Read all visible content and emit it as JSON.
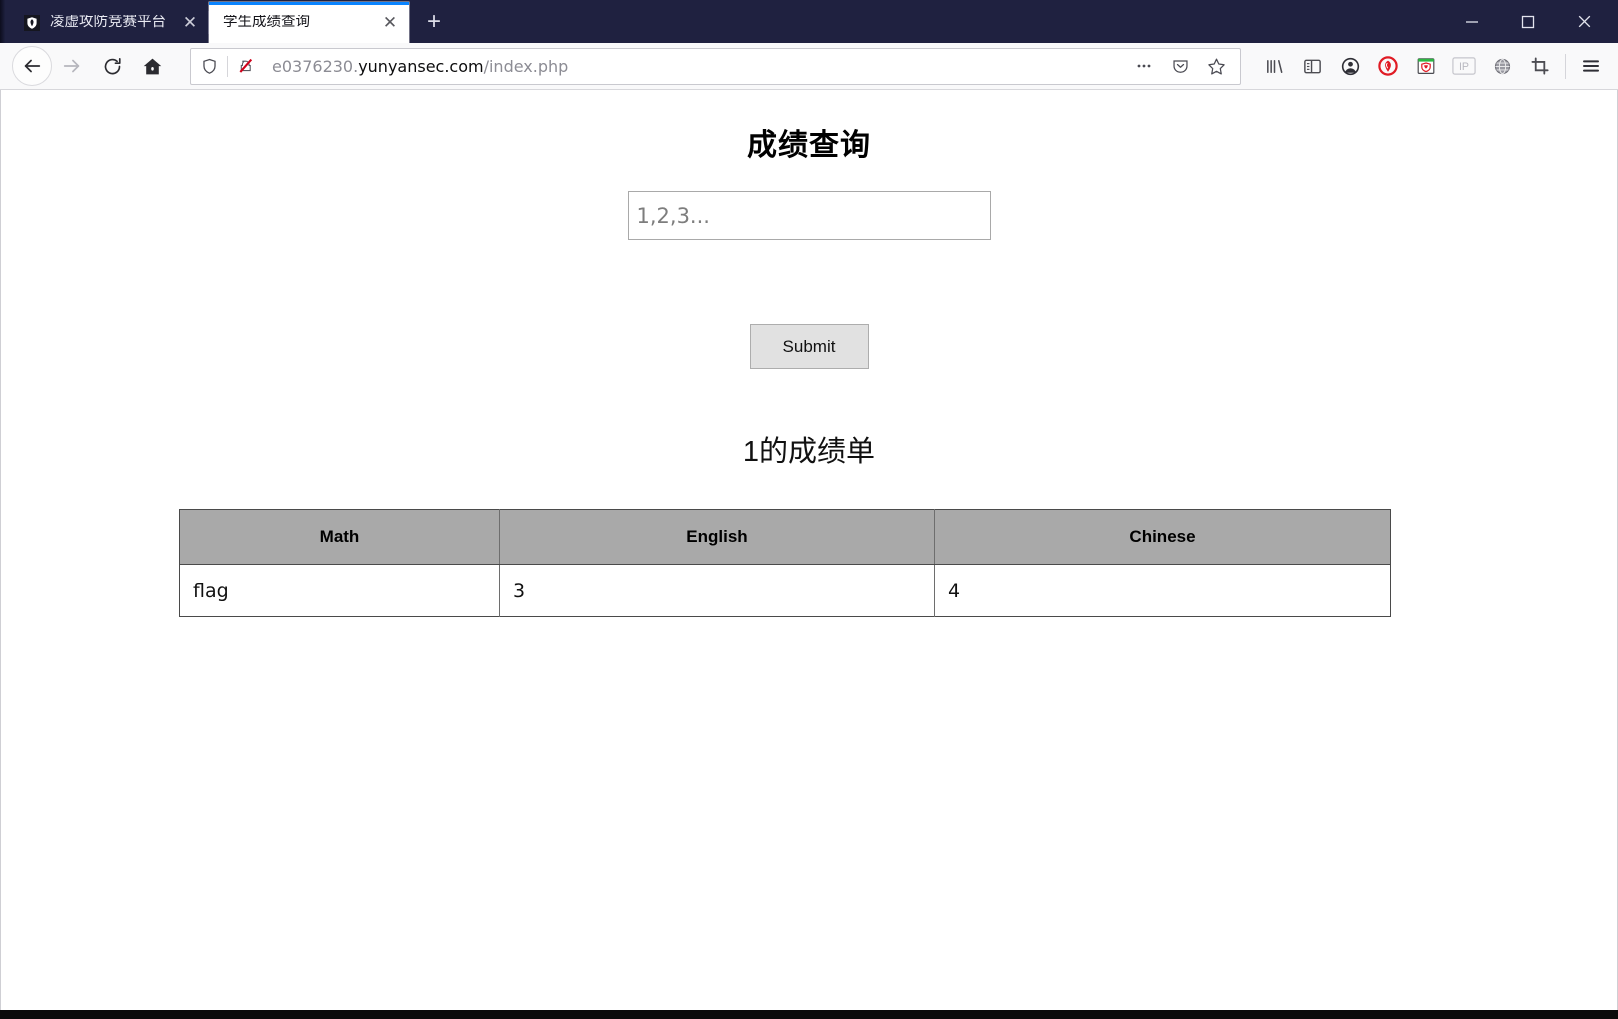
{
  "browser": {
    "tabs": [
      {
        "title": "凌虚攻防竞赛平台",
        "favicon": "shield-icon",
        "active": false,
        "close_label": "✕"
      },
      {
        "title": "学生成绩查询",
        "favicon": "none",
        "active": true,
        "close_label": "✕"
      }
    ],
    "new_tab_label": "+",
    "window_controls": {
      "minimize": "minimize-icon",
      "maximize": "maximize-icon",
      "close": "close-icon"
    },
    "nav": {
      "back": "back-arrow-icon",
      "forward": "forward-arrow-icon",
      "reload": "reload-icon",
      "home": "home-icon"
    },
    "urlbar": {
      "tracking_protection": "shield-icon",
      "connection": "insecure-lock-icon",
      "url_prefix": "e0376230.",
      "url_host": "yunyansec.com",
      "url_path": "/index.php",
      "url_full": "e0376230.yunyansec.com/index.php",
      "page_actions": "ellipsis-icon",
      "pocket": "pocket-icon",
      "bookmark": "star-icon"
    },
    "toolbar_icons": [
      "library-icon",
      "sidebar-icon",
      "account-icon",
      "adblock-icon",
      "hackbar-icon",
      "ip-icon",
      "proxy-globe-icon",
      "screenshot-crop-icon"
    ],
    "menu_icon": "hamburger-menu-icon"
  },
  "page": {
    "title": "成绩查询",
    "query_input": {
      "value": "",
      "placeholder": "1,2,3..."
    },
    "submit_label": "Submit",
    "result_heading": "1的成绩单",
    "table": {
      "headers": [
        "Math",
        "English",
        "Chinese"
      ],
      "rows": [
        [
          "flag",
          "3",
          "4"
        ]
      ]
    }
  },
  "colors": {
    "titlebar_bg": "#1f2140",
    "active_tab_accent": "#0a84ff",
    "table_header_bg": "#a9a9a9",
    "button_bg": "#e1e1e1"
  }
}
